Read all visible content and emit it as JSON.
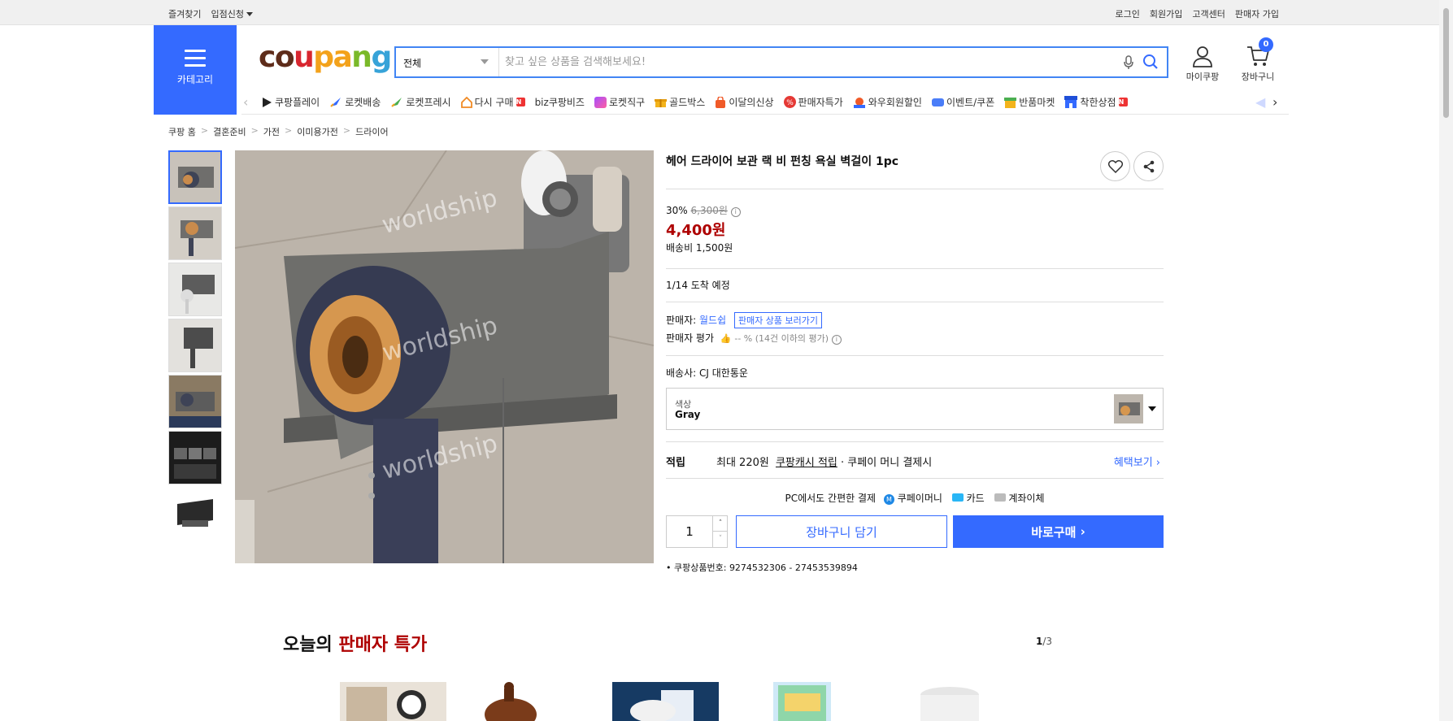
{
  "topbar": {
    "left": [
      "즐겨찾기",
      "입점신청"
    ],
    "right": [
      "로그인",
      "회원가입",
      "고객센터",
      "판매자 가입"
    ]
  },
  "header": {
    "category_label": "카테고리",
    "logo": "coupang",
    "search_scope": "전체",
    "search_placeholder": "찾고 싶은 상품을 검색해보세요!",
    "my_coupang": "마이쿠팡",
    "cart_label": "장바구니",
    "cart_count": "0"
  },
  "quick_nav": [
    "쿠팡플레이",
    "로켓배송",
    "로켓프레시",
    "다시 구매",
    "biz쿠팡비즈",
    "로켓직구",
    "골드박스",
    "이달의신상",
    "판매자특가",
    "와우회원할인",
    "이벤트/쿠폰",
    "반품마켓",
    "착한상점"
  ],
  "breadcrumb": [
    "쿠팡 홈",
    "결혼준비",
    "가전",
    "이미용가전",
    "드라이어"
  ],
  "product": {
    "title": "헤어 드라이어 보관 랙 비 펀칭 욕실 벽걸이 1pc",
    "discount_rate": "30%",
    "original_price": "6,300원",
    "price": "4,400원",
    "shipping_fee": "배송비 1,500원",
    "arrival": "1/14 도착 예정",
    "seller_label": "판매자:",
    "seller_name": "월드쉽",
    "seller_btn": "판매자 상품 보러가기",
    "rating_label": "판매자 평가",
    "rating_value": "-- % (14건 이하의 평가)",
    "courier_label": "배송사:",
    "courier": "CJ 대한통운",
    "option_label": "색상",
    "option_value": "Gray",
    "reward_label": "적립",
    "reward_amount": "최대 220원",
    "reward_link": "쿠팡캐시 적립",
    "reward_tail": "· 쿠페이 머니 결제시",
    "benefit_btn": "혜택보기",
    "pay_title": "PC에서도 간편한 결제",
    "pay_options": [
      "쿠페이머니",
      "카드",
      "계좌이체"
    ],
    "quantity": "1",
    "add_cart": "장바구니 담기",
    "buy_now": "바로구매",
    "product_no_label": "쿠팡상품번호:",
    "product_no": "9274532306 - 27453539894",
    "watermark": "worldship"
  },
  "section": {
    "title_prefix": "오늘의",
    "title_highlight": "판매자 특가",
    "page_current": "1",
    "page_total": "/3"
  },
  "colors": {
    "accent": "#346aff",
    "price": "#ae0000"
  }
}
